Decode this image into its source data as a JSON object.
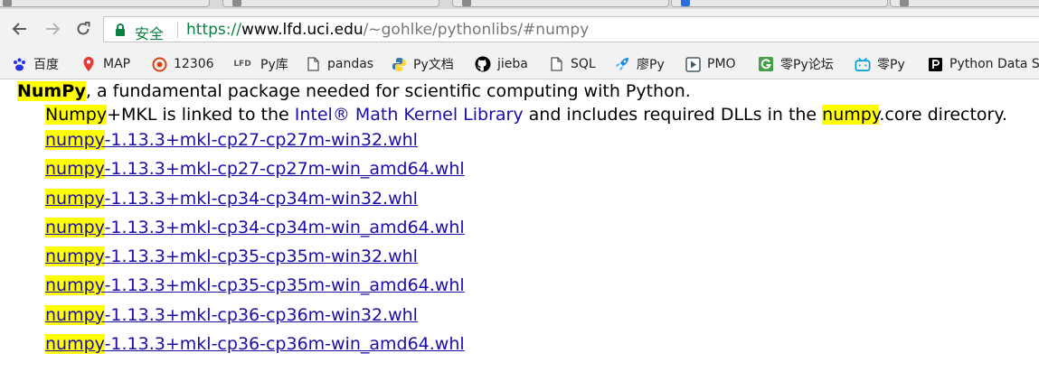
{
  "browser": {
    "tabs": [
      {
        "label": "",
        "favicon_color": "#8a8a8a"
      },
      {
        "label": "",
        "favicon_color": "#8a8a8a"
      },
      {
        "label": "",
        "favicon_color": "#8a8a8a"
      },
      {
        "label": "",
        "favicon_color": "#2a6fdb"
      },
      {
        "label": "",
        "favicon_color": "#8a8a8a"
      }
    ],
    "address": {
      "secure_label": "安全",
      "scheme": "https://",
      "host": "www.lfd.uci.edu",
      "path": "/~gohlke/pythonlibs/#numpy"
    },
    "bookmarks": [
      {
        "label": "百度",
        "icon": "baidu-paw-icon",
        "color": "#2932e1"
      },
      {
        "label": "MAP",
        "icon": "map-pin-icon",
        "color": "#e53935"
      },
      {
        "label": "12306",
        "icon": "railway-icon",
        "color": "#d84315"
      },
      {
        "label": "Py库",
        "icon": "lfd-icon",
        "color": "#555555",
        "icon_text": "LFD"
      },
      {
        "label": "pandas",
        "icon": "page-icon",
        "color": "#555555"
      },
      {
        "label": "Py文档",
        "icon": "python-icon",
        "color": "#3776ab"
      },
      {
        "label": "jieba",
        "icon": "github-icon",
        "color": "#000000"
      },
      {
        "label": "SQL",
        "icon": "page-icon",
        "color": "#555555"
      },
      {
        "label": "廖Py",
        "icon": "rocket-icon",
        "color": "#1e88e5"
      },
      {
        "label": "PMO",
        "icon": "play-icon",
        "color": "#455a64"
      },
      {
        "label": "零Py论坛",
        "icon": "g-icon",
        "color": "#43a047"
      },
      {
        "label": "零Py",
        "icon": "bilibili-icon",
        "color": "#00a1d6"
      },
      {
        "label": "Python Data S",
        "icon": "p-square-icon",
        "color": "#000000"
      }
    ]
  },
  "page": {
    "package": {
      "name": "NumPy",
      "summary": ", a fundamental package needed for scientific computing with Python.",
      "desc_name": "Numpy",
      "desc_1": "+MKL is linked to the ",
      "desc_link": "Intel® Math Kernel Library",
      "desc_2": " and includes required DLLs in the ",
      "desc_hl": "numpy",
      "desc_3": ".core directory."
    },
    "files": [
      {
        "prefix": "numpy",
        "rest": "-1.13.3+mkl-cp27-cp27m-win32.whl"
      },
      {
        "prefix": "numpy",
        "rest": "-1.13.3+mkl-cp27-cp27m-win_amd64.whl"
      },
      {
        "prefix": "numpy",
        "rest": "-1.13.3+mkl-cp34-cp34m-win32.whl"
      },
      {
        "prefix": "numpy",
        "rest": "-1.13.3+mkl-cp34-cp34m-win_amd64.whl"
      },
      {
        "prefix": "numpy",
        "rest": "-1.13.3+mkl-cp35-cp35m-win32.whl"
      },
      {
        "prefix": "numpy",
        "rest": "-1.13.3+mkl-cp35-cp35m-win_amd64.whl"
      },
      {
        "prefix": "numpy",
        "rest": "-1.13.3+mkl-cp36-cp36m-win32.whl"
      },
      {
        "prefix": "numpy",
        "rest": "-1.13.3+mkl-cp36-cp36m-win_amd64.whl"
      }
    ],
    "highlight_color": "#ffff00",
    "link_color": "#1a0dab"
  }
}
